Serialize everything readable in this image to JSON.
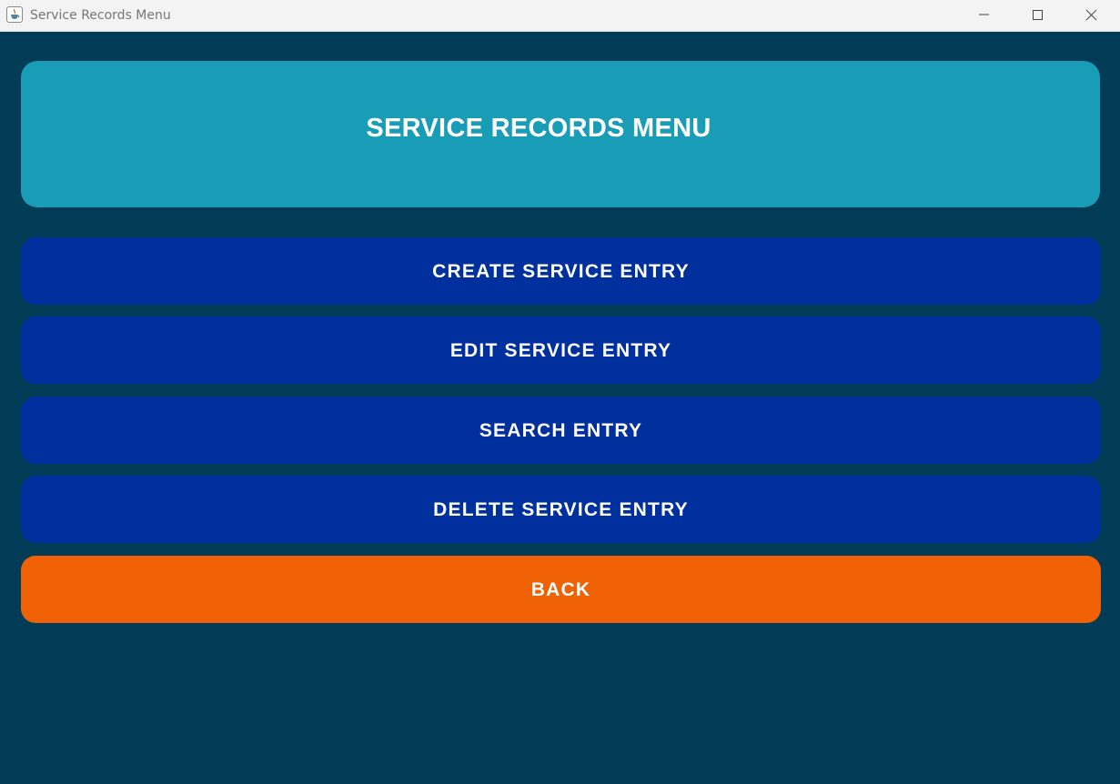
{
  "window": {
    "title": "Service Records Menu",
    "icons": {
      "app": "java-cup-icon",
      "minimize": "minimize-icon",
      "maximize": "maximize-icon",
      "close": "close-icon"
    }
  },
  "header": {
    "title": "SERVICE RECORDS MENU"
  },
  "menu": {
    "create_label": "CREATE SERVICE ENTRY",
    "edit_label": "EDIT SERVICE ENTRY",
    "search_label": "SEARCH ENTRY",
    "delete_label": "DELETE SERVICE ENTRY",
    "back_label": "BACK"
  },
  "colors": {
    "background": "#023c57",
    "header_panel": "#199cb6",
    "menu_button": "#002f9e",
    "back_button": "#ef6104",
    "button_text": "#ffffff"
  }
}
